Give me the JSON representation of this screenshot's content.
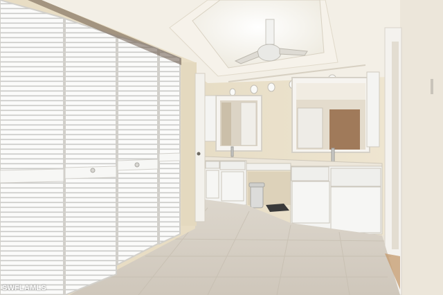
{
  "photo": {
    "subject": "bathroom",
    "watermark": "SWFLAMLS"
  },
  "colors": {
    "wall": "#e8dcc0",
    "ceiling": "#f3efe6",
    "cabinet": "#f4f4f2",
    "floor": "#d8d0c4",
    "louver_door": "#fbfbfa",
    "counter": "#ece6da"
  },
  "icons": [
    "ceiling-fan-icon",
    "track-light-icon",
    "trash-can-icon",
    "floor-scale-icon"
  ]
}
